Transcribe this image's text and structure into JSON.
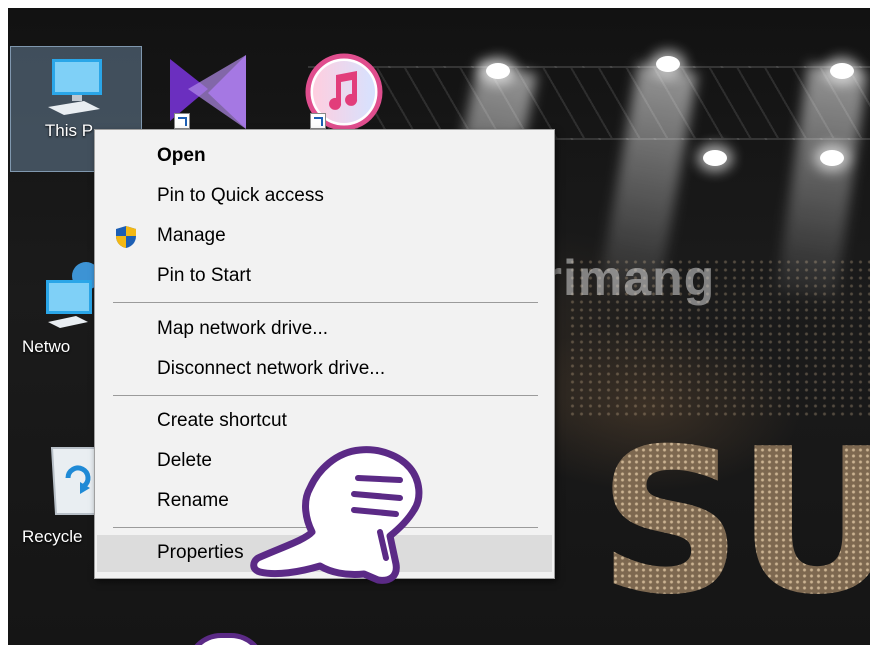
{
  "desktop": {
    "icons": [
      {
        "label": "This P",
        "icon": "monitor-icon"
      },
      {
        "label": "",
        "icon": "visual-studio-icon"
      },
      {
        "label": "",
        "icon": "itunes-icon"
      },
      {
        "label": "Netwo",
        "icon": "network-icon"
      },
      {
        "label": "Recycle",
        "icon": "recycle-bin-icon"
      }
    ],
    "wallpaper_text": "SUF",
    "watermark": "uantrimang"
  },
  "context_menu": {
    "items": [
      {
        "label": "Open",
        "bold": true
      },
      {
        "label": "Pin to Quick access"
      },
      {
        "label": "Manage",
        "icon": "uac-shield-icon"
      },
      {
        "label": "Pin to Start"
      },
      {
        "label": "Map network drive..."
      },
      {
        "label": "Disconnect network drive..."
      },
      {
        "label": "Create shortcut"
      },
      {
        "label": "Delete"
      },
      {
        "label": "Rename"
      },
      {
        "label": "Properties",
        "highlighted": true
      }
    ]
  },
  "colors": {
    "menu_bg": "#f2f2f2",
    "highlight": "#dcdcdc",
    "hand_outline": "#5b2a86"
  }
}
